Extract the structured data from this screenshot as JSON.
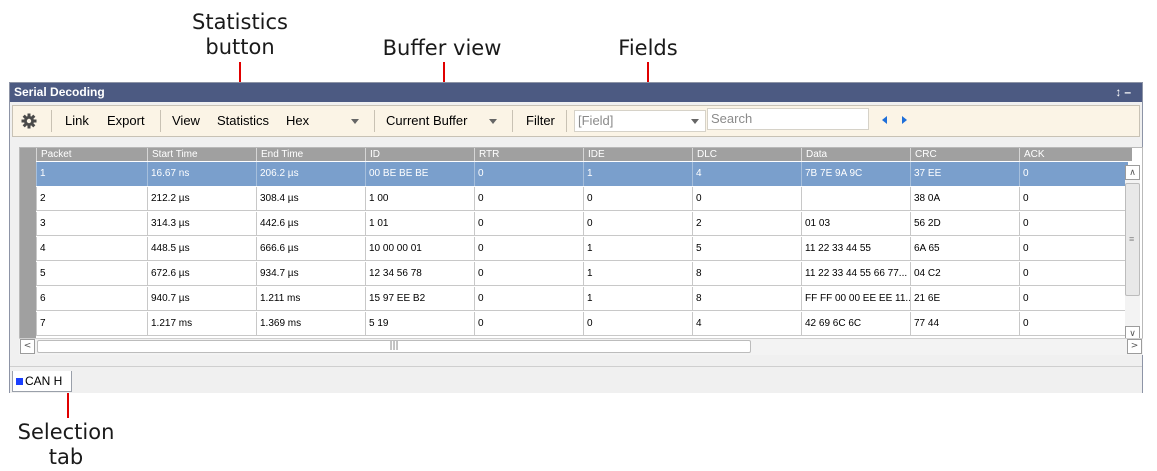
{
  "annotations": {
    "statistics_button": "Statistics\nbutton",
    "buffer_view": "Buffer view",
    "fields": "Fields",
    "selection_tab": "Selection\ntab"
  },
  "window": {
    "title": "Serial Decoding",
    "title_icons": "↕ –"
  },
  "toolbar": {
    "settings_icon": "gear-icon",
    "link_label": "Link",
    "export_label": "Export",
    "view_label": "View",
    "statistics_label": "Statistics",
    "format_value": "Hex",
    "buffer_value": "Current Buffer",
    "filter_label": "Filter",
    "field_placeholder": "[Field]",
    "search_placeholder": "Search"
  },
  "table": {
    "columns": [
      "Packet",
      "Start Time",
      "End Time",
      "ID",
      "RTR",
      "IDE",
      "DLC",
      "Data",
      "CRC",
      "ACK"
    ],
    "rows": [
      [
        "1",
        "16.67 ns",
        "206.2 µs",
        "00 BE BE BE",
        "0",
        "1",
        "4",
        "7B 7E 9A 9C",
        "37 EE",
        "0"
      ],
      [
        "2",
        "212.2 µs",
        "308.4 µs",
        "1 00",
        "0",
        "0",
        "0",
        "",
        "38 0A",
        "0"
      ],
      [
        "3",
        "314.3 µs",
        "442.6 µs",
        "1 01",
        "0",
        "0",
        "2",
        "01 03",
        "56 2D",
        "0"
      ],
      [
        "4",
        "448.5 µs",
        "666.6 µs",
        "10 00 00 01",
        "0",
        "1",
        "5",
        "11 22 33 44 55",
        "6A 65",
        "0"
      ],
      [
        "5",
        "672.6 µs",
        "934.7 µs",
        "12 34 56 78",
        "0",
        "1",
        "8",
        "11 22 33 44 55 66 77...",
        "04 C2",
        "0"
      ],
      [
        "6",
        "940.7 µs",
        "1.211 ms",
        "15 97 EE B2",
        "0",
        "1",
        "8",
        "FF FF 00 00 EE EE 11...",
        "21 6E",
        "0"
      ],
      [
        "7",
        "1.217 ms",
        "1.369 ms",
        "5 19",
        "0",
        "0",
        "4",
        "42 69 6C 6C",
        "77 44",
        "0"
      ]
    ],
    "selected_row": 0
  },
  "tabs": [
    {
      "label": "CAN H",
      "color": "#1a3fff"
    }
  ],
  "colors": {
    "callout": "#e00000",
    "titlebar": "#4c5a82",
    "selection": "#7a9fcc",
    "toolbar": "#fbf4e6"
  }
}
